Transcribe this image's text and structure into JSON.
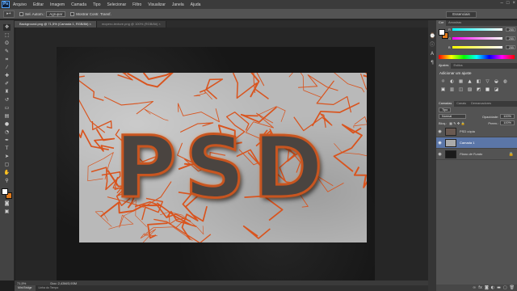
{
  "app": {
    "logo": "Ps"
  },
  "menu": [
    "Arquivo",
    "Editar",
    "Imagem",
    "Camada",
    "Tipo",
    "Selecionar",
    "Filtro",
    "Visualizar",
    "Janela",
    "Ajuda"
  ],
  "window_controls": [
    "–",
    "□",
    "×"
  ],
  "options_bar": {
    "tool_label": "▸+",
    "auto_select_label": "Sel. Autom.:",
    "auto_select_value": "Agrupar",
    "show_transform_label": "Mostrar Contr. Transf."
  },
  "workspace": "Essenciais",
  "doc_tabs": [
    {
      "label": "Background.png @ 71,5% (Camada 1, RGB/8#) ×",
      "active": true
    },
    {
      "label": "mopero-texture.png @ 100% (RGB/8#) ×",
      "active": false
    }
  ],
  "artwork": {
    "text": "PSD",
    "background_color": "#b9b9b9",
    "crack_color": "#d9541e",
    "letter_color": "#4a4440"
  },
  "status": {
    "zoom": "71,5%",
    "doc": "Doc: 2,43M/3,93M"
  },
  "bottom_tabs": [
    "Mini Bridge",
    "Linha do Tempo"
  ],
  "color_panel": {
    "tabs": [
      "Cor",
      "Amostras"
    ],
    "channels": [
      {
        "label": "R",
        "value": "255",
        "color": "#e02020"
      },
      {
        "label": "G",
        "value": "255",
        "color": "#20c020"
      },
      {
        "label": "B",
        "value": "255",
        "color": "#2050e0"
      }
    ],
    "fg_color": "#ffffff",
    "bg_color": "#e07a1c"
  },
  "adjustments_panel": {
    "tabs": [
      "Ajustes",
      "Estilos"
    ],
    "heading": "Adicionar um ajuste",
    "icons": [
      "☼",
      "◐",
      "▦",
      "▲",
      "◧",
      "▽",
      "◒",
      "◍",
      "▣",
      "▥",
      "◫",
      "▨",
      "◩",
      "■",
      "◪"
    ]
  },
  "layers_panel": {
    "tabs": [
      "Camadas",
      "Canais",
      "Demarcadores"
    ],
    "kind_filter": "Tipo",
    "blend_mode": "Normal",
    "opacity_label": "Opacidade:",
    "opacity_value": "100%",
    "lock_label": "Bloq.:",
    "fill_label": "Preen.:",
    "fill_value": "100%",
    "layers": [
      {
        "name": "PSD cópia",
        "active": false,
        "thumb_color": "#6a5a52",
        "locked": false
      },
      {
        "name": "Camada 1",
        "active": true,
        "thumb_color": "#aaaaaa",
        "locked": false
      },
      {
        "name": "Plano de Fundo",
        "active": false,
        "thumb_color": "#1a1a1a",
        "locked": true
      }
    ]
  }
}
